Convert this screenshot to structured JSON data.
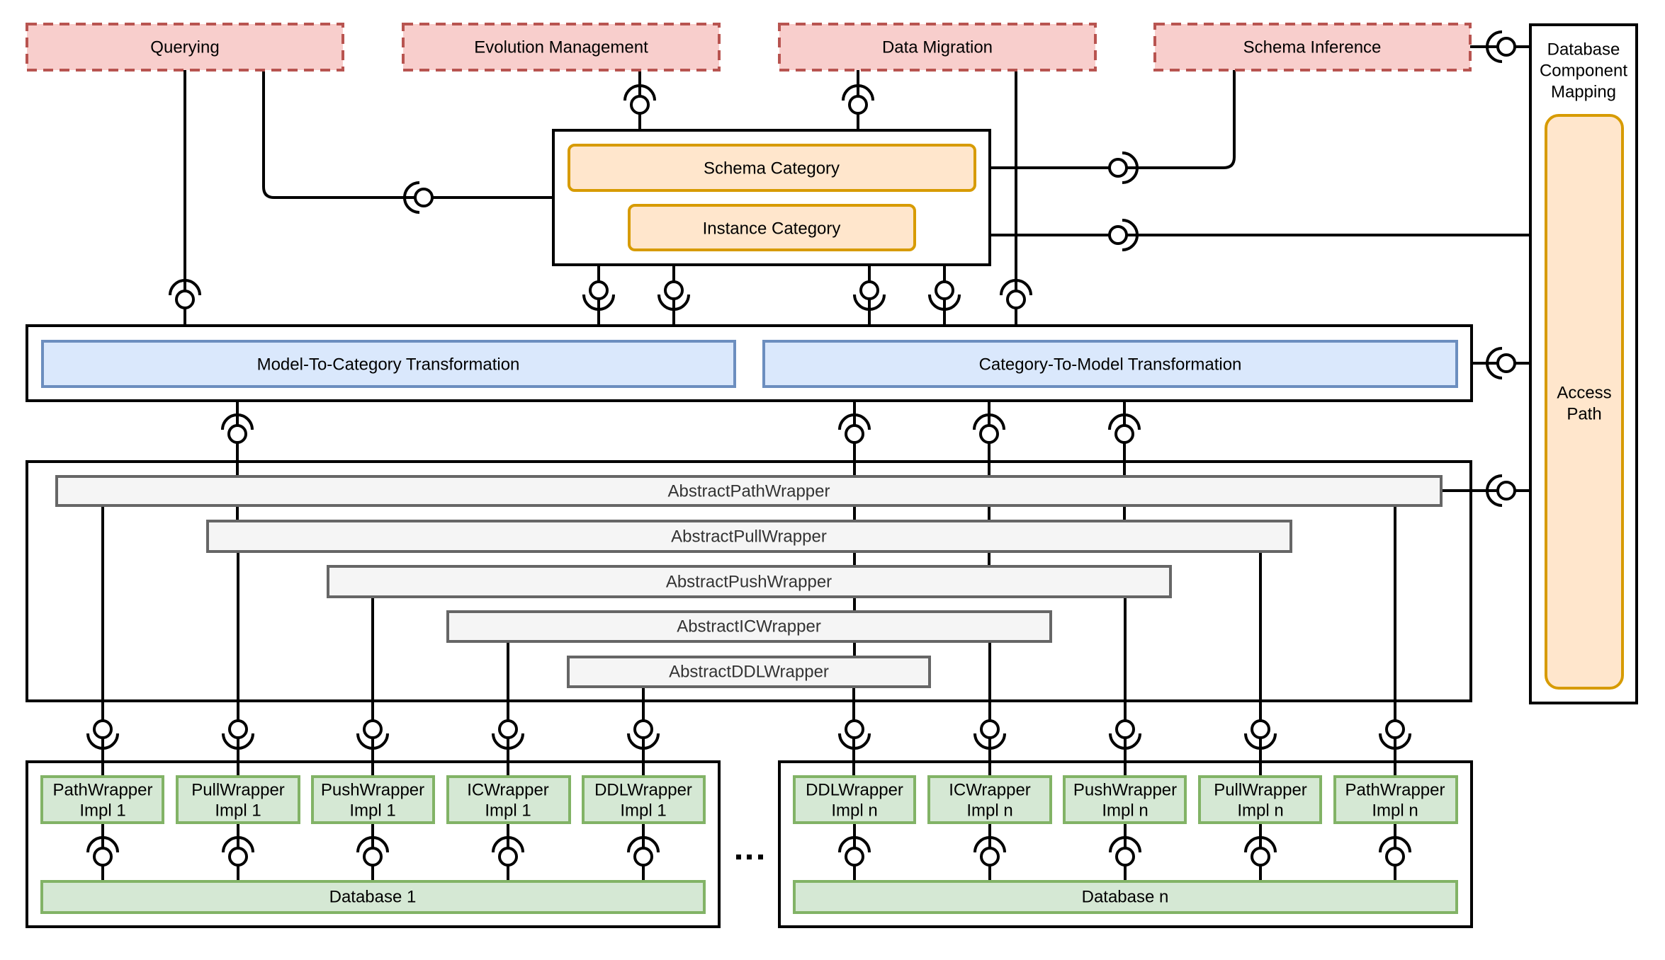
{
  "diagram": {
    "applications": [
      {
        "id": "querying",
        "label": "Querying"
      },
      {
        "id": "evolution",
        "label": "Evolution Management"
      },
      {
        "id": "migration",
        "label": "Data Migration"
      },
      {
        "id": "inference",
        "label": "Schema Inference"
      }
    ],
    "categories": {
      "schema": "Schema Category",
      "instance": "Instance Category"
    },
    "mapping": {
      "title_lines": [
        "Database",
        "Component",
        "Mapping"
      ],
      "access_path_lines": [
        "Access",
        "Path"
      ]
    },
    "transformations": {
      "model_to_category": "Model-To-Category Transformation",
      "category_to_model": "Category-To-Model Transformation"
    },
    "abstract_wrappers": [
      "AbstractPathWrapper",
      "AbstractPullWrapper",
      "AbstractPushWrapper",
      "AbstractICWrapper",
      "AbstractDDLWrapper"
    ],
    "database_1": {
      "label": "Database 1",
      "impls": [
        [
          "PathWrapper",
          "Impl 1"
        ],
        [
          "PullWrapper",
          "Impl 1"
        ],
        [
          "PushWrapper",
          "Impl 1"
        ],
        [
          "ICWrapper",
          "Impl 1"
        ],
        [
          "DDLWrapper",
          "Impl 1"
        ]
      ]
    },
    "database_n": {
      "label": "Database n",
      "impls": [
        [
          "DDLWrapper",
          "Impl n"
        ],
        [
          "ICWrapper",
          "Impl n"
        ],
        [
          "PushWrapper",
          "Impl n"
        ],
        [
          "PullWrapper",
          "Impl n"
        ],
        [
          "PathWrapper",
          "Impl n"
        ]
      ]
    },
    "ellipsis": "..."
  }
}
